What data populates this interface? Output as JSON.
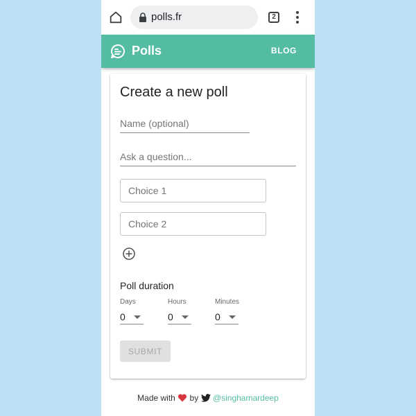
{
  "browser": {
    "url": "polls.fr",
    "tab_count": "2"
  },
  "appbar": {
    "title": "Polls",
    "blog_label": "BLOG"
  },
  "form": {
    "title": "Create a new poll",
    "name_placeholder": "Name (optional)",
    "question_placeholder": "Ask a question...",
    "choices": [
      {
        "placeholder": "Choice 1"
      },
      {
        "placeholder": "Choice 2"
      }
    ],
    "duration": {
      "label": "Poll duration",
      "days_label": "Days",
      "days_value": "0",
      "hours_label": "Hours",
      "hours_value": "0",
      "minutes_label": "Minutes",
      "minutes_value": "0"
    },
    "submit_label": "SUBMIT"
  },
  "footer": {
    "made_with": "Made with",
    "by": "by",
    "handle": "@singhamardeep"
  },
  "colors": {
    "accent": "#55bca4",
    "background": "#bde0f6",
    "heart": "#d9363e",
    "twitter": "#222222"
  },
  "icons": [
    "home-icon",
    "lock-icon",
    "tabs-icon",
    "more-vert-icon",
    "poll-chat-icon",
    "add-circle-icon",
    "heart-icon",
    "twitter-icon"
  ]
}
